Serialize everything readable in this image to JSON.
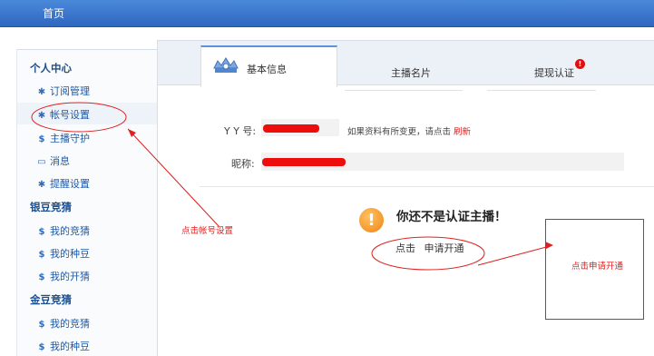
{
  "topbar": {
    "home_label": "首页"
  },
  "sidebar": {
    "sections": [
      {
        "title": "个人中心",
        "items": [
          {
            "label": "订阅管理",
            "icon": "gear-icon"
          },
          {
            "label": "帐号设置",
            "icon": "gear-icon"
          },
          {
            "label": "主播守护",
            "icon": "dollar-icon"
          },
          {
            "label": "消息",
            "icon": "message-icon"
          },
          {
            "label": "提醒设置",
            "icon": "gear-icon"
          }
        ]
      },
      {
        "title": "银豆竞猜",
        "items": [
          {
            "label": "我的竞猜",
            "icon": "dollar-icon"
          },
          {
            "label": "我的种豆",
            "icon": "dollar-icon"
          },
          {
            "label": "我的开猜",
            "icon": "dollar-icon"
          }
        ]
      },
      {
        "title": "金豆竞猜",
        "items": [
          {
            "label": "我的竞猜",
            "icon": "dollar-icon"
          },
          {
            "label": "我的种豆",
            "icon": "dollar-icon"
          }
        ]
      }
    ]
  },
  "tabs": [
    {
      "label": "基本信息",
      "active": true,
      "icon": "badge-icon"
    },
    {
      "label": "主播名片",
      "active": false
    },
    {
      "label": "提现认证",
      "active": false,
      "alert_icon": "exclamation-icon"
    }
  ],
  "profile": {
    "yy_label": "Y Y 号:",
    "refresh_note": "如果资料有所变更，请点击",
    "refresh_link": "刷新",
    "nickname_label": "昵称:"
  },
  "notice": {
    "headline": "你还不是认证主播！",
    "click_prefix": "点击",
    "apply_link": "申请开通"
  },
  "annotations": {
    "account_hint": "点击帐号设置",
    "apply_hint": "点击申请开通"
  },
  "colors": {
    "topbar": "#2f67bf",
    "link": "#1f5aa6",
    "annotation": "#e51c1c"
  }
}
